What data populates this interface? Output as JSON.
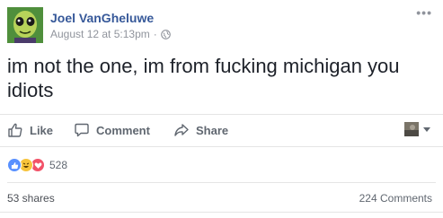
{
  "post": {
    "author": "Joel VanGheluwe",
    "timestamp": "August 12 at 5:13pm",
    "separator": "·",
    "privacy_icon": "globe-icon",
    "menu_icon": "more-options-icon",
    "text": "im not the one, im from fucking michigan you idiots"
  },
  "actions": {
    "like_label": "Like",
    "comment_label": "Comment",
    "share_label": "Share"
  },
  "reactions": {
    "types": [
      "like",
      "haha",
      "love"
    ],
    "count": "528"
  },
  "footer": {
    "shares": "53 shares",
    "comments": "224 Comments"
  },
  "colors": {
    "link": "#365899",
    "secondary": "#90949c",
    "like_blue": "#5890ff",
    "haha_yellow": "#f7c33b",
    "love_red": "#f25268"
  }
}
